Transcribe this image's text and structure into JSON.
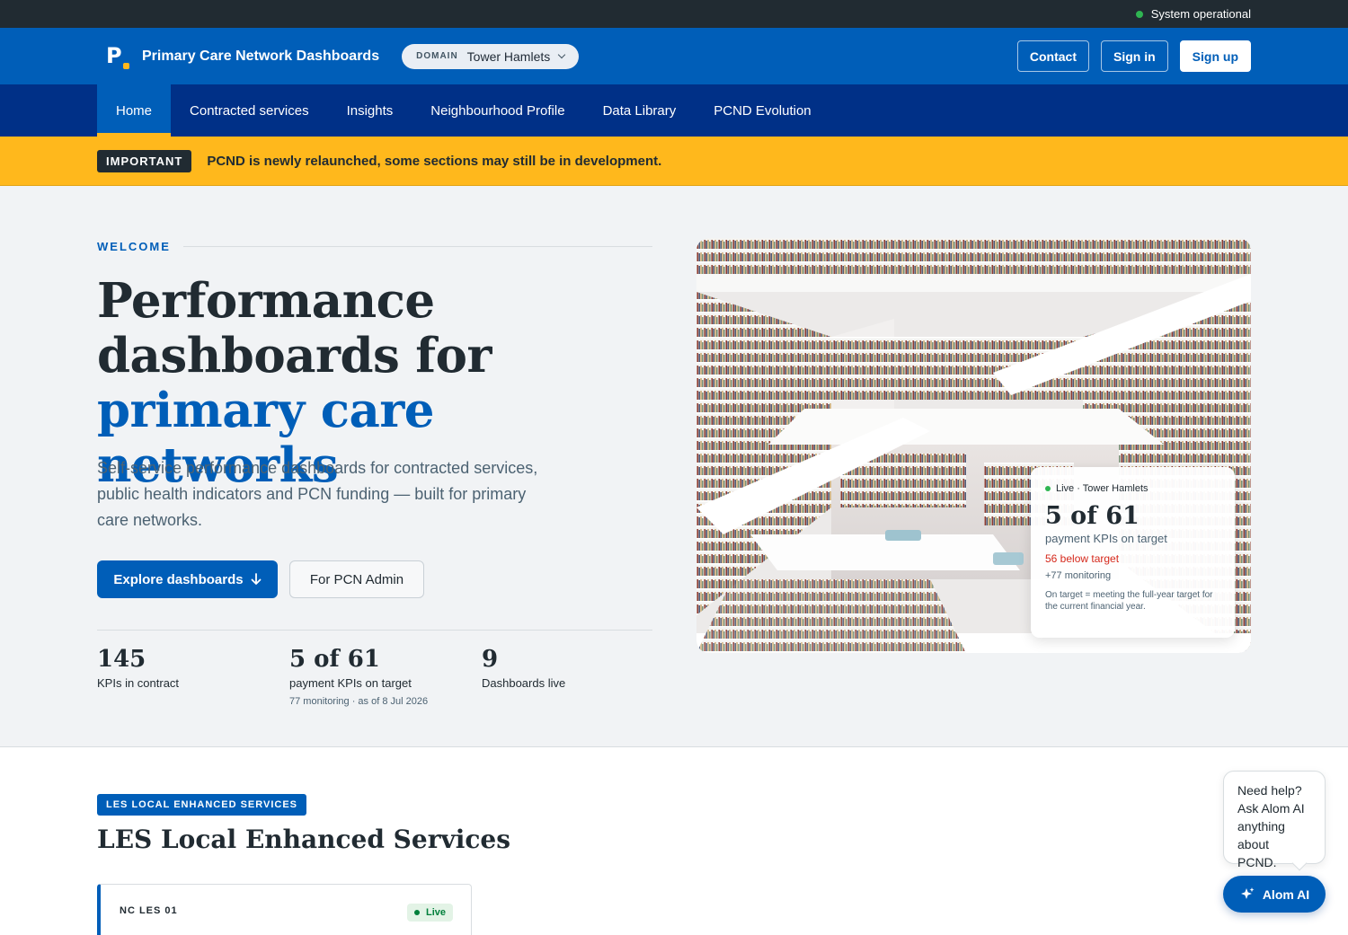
{
  "status": {
    "text": "System operational",
    "color": "#2fb552"
  },
  "header": {
    "logo_letter": "P",
    "title": "Primary Care Network Dashboards",
    "domain_label": "DOMAIN",
    "domain_value": "Tower Hamlets",
    "contact": "Contact",
    "sign_in": "Sign in",
    "sign_up": "Sign up"
  },
  "nav": {
    "items": [
      "Home",
      "Contracted services",
      "Insights",
      "Neighbourhood Profile",
      "Data Library",
      "PCND Evolution"
    ],
    "active": "Home"
  },
  "banner": {
    "tag": "IMPORTANT",
    "text": "PCND is newly relaunched, some sections may still be in development."
  },
  "hero": {
    "eyebrow": "WELCOME",
    "title_plain": "Performance dashboards for",
    "title_accent": "primary care networks",
    "subtitle": "Self-service performance dashboards for contracted services, public health indicators and PCN funding — built for primary care networks.",
    "primary_button": "Explore dashboards",
    "secondary_button": "For PCN Admin",
    "image_desc_icon": "library-photo"
  },
  "stats": [
    {
      "value": "145",
      "label": "KPIs in contract",
      "meta": ""
    },
    {
      "value": "5 of 61",
      "label": "payment KPIs on target",
      "meta": "77 monitoring · as of 8 Jul 2026"
    },
    {
      "value": "9",
      "label": "Dashboards live",
      "meta": ""
    }
  ],
  "live_card": {
    "status": "Live · Tower Hamlets",
    "value": "5 of 61",
    "label": "payment KPIs on target",
    "below": "56 below target",
    "monitoring": "+77 monitoring",
    "note": "On target = meeting the full-year target for the current financial year."
  },
  "les": {
    "tag": "LES LOCAL ENHANCED SERVICES",
    "title": "LES Local Enhanced Services",
    "card_code": "NC LES 01",
    "card_status": "Live"
  },
  "chat": {
    "help_text": "Need help? Ask Alom AI anything about PCND.",
    "button": "Alom AI"
  },
  "colors": {
    "brand": "#005eb8",
    "nav": "#003087",
    "warning": "#ffb81c",
    "dark": "#212b32",
    "alert": "#d5281b"
  }
}
